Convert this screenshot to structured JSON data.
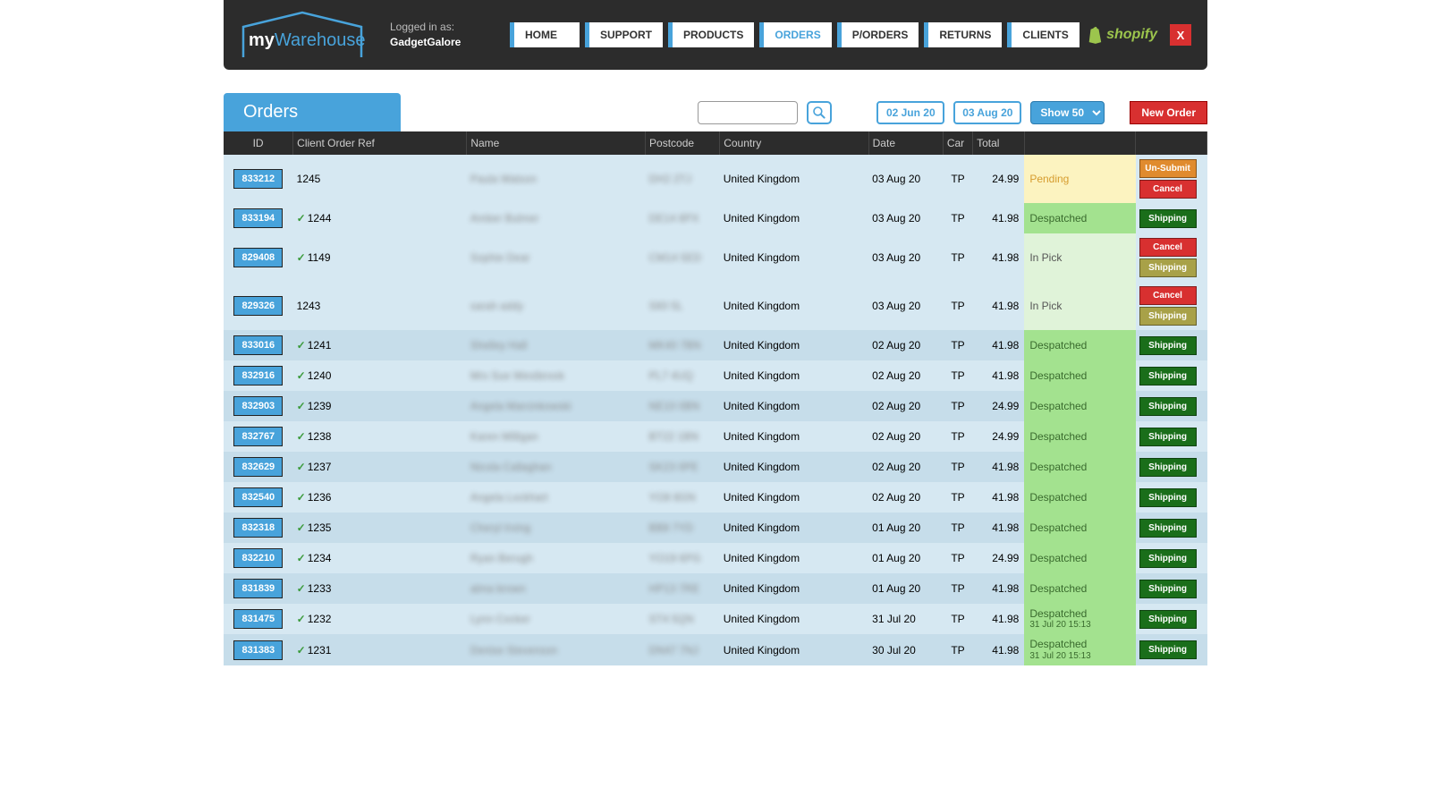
{
  "header": {
    "logo_prefix": "my",
    "logo_suffix": "Warehouse",
    "logged_in_label": "Logged in as:",
    "client_name": "GadgetGalore",
    "shopify_label": "shopify",
    "close_label": "X"
  },
  "nav": [
    {
      "label": "HOME"
    },
    {
      "label": "SUPPORT"
    },
    {
      "label": "PRODUCTS"
    },
    {
      "label": "ORDERS",
      "active": true
    },
    {
      "label": "P/ORDERS"
    },
    {
      "label": "RETURNS"
    },
    {
      "label": "CLIENTS"
    }
  ],
  "toolbar": {
    "title": "Orders",
    "date_from": "02 Jun 20",
    "date_to": "03 Aug 20",
    "show_label": "Show 50",
    "new_order_label": "New Order"
  },
  "columns": {
    "id": "ID",
    "ref": "Client Order Ref",
    "name": "Name",
    "postcode": "Postcode",
    "country": "Country",
    "date": "Date",
    "car": "Car",
    "total": "Total"
  },
  "statuses": {
    "pending": "Pending",
    "despatched": "Despatched",
    "inpick": "In Pick"
  },
  "actions": {
    "unsubmit": "Un-Submit",
    "cancel": "Cancel",
    "shipping": "Shipping"
  },
  "rows": [
    {
      "id": "833212",
      "chk": false,
      "ref": "1245",
      "name": "Paula Watson",
      "post": "DH2 2TJ",
      "country": "United Kingdom",
      "date": "03 Aug 20",
      "car": "TP",
      "total": "24.99",
      "status": "pending",
      "actions": [
        "unsubmit",
        "cancel"
      ]
    },
    {
      "id": "833194",
      "chk": true,
      "ref": "1244",
      "name": "Amber Bulmer",
      "post": "DE14 8PX",
      "country": "United Kingdom",
      "date": "03 Aug 20",
      "car": "TP",
      "total": "41.98",
      "status": "despatched",
      "actions": [
        "shipping-green"
      ]
    },
    {
      "id": "829408",
      "chk": true,
      "ref": "1149",
      "name": "Sophie Dear",
      "post": "CM14 5ED",
      "country": "United Kingdom",
      "date": "03 Aug 20",
      "car": "TP",
      "total": "41.98",
      "status": "inpick",
      "actions": [
        "cancel",
        "shipping-olive"
      ]
    },
    {
      "id": "829326",
      "chk": false,
      "ref": "1243",
      "name": "sarah addy",
      "post": "S60 5L",
      "country": "United Kingdom",
      "date": "03 Aug 20",
      "car": "TP",
      "total": "41.98",
      "status": "inpick",
      "actions": [
        "cancel",
        "shipping-olive"
      ]
    },
    {
      "id": "833016",
      "chk": true,
      "ref": "1241",
      "name": "Shelley Hall",
      "post": "MK40 7BN",
      "country": "United Kingdom",
      "date": "02 Aug 20",
      "car": "TP",
      "total": "41.98",
      "status": "despatched",
      "actions": [
        "shipping-green"
      ]
    },
    {
      "id": "832916",
      "chk": true,
      "ref": "1240",
      "name": "Mrs Sue Westbrook",
      "post": "PL7 4UQ",
      "country": "United Kingdom",
      "date": "02 Aug 20",
      "car": "TP",
      "total": "41.98",
      "status": "despatched",
      "actions": [
        "shipping-green"
      ]
    },
    {
      "id": "832903",
      "chk": true,
      "ref": "1239",
      "name": "Angela Marcinkowski",
      "post": "NE10 0BN",
      "country": "United Kingdom",
      "date": "02 Aug 20",
      "car": "TP",
      "total": "24.99",
      "status": "despatched",
      "actions": [
        "shipping-green"
      ]
    },
    {
      "id": "832767",
      "chk": true,
      "ref": "1238",
      "name": "Karen Milligan",
      "post": "BT22 1BN",
      "country": "United Kingdom",
      "date": "02 Aug 20",
      "car": "TP",
      "total": "24.99",
      "status": "despatched",
      "actions": [
        "shipping-green"
      ]
    },
    {
      "id": "832629",
      "chk": true,
      "ref": "1237",
      "name": "Nicola Callaghan",
      "post": "SK23 0PE",
      "country": "United Kingdom",
      "date": "02 Aug 20",
      "car": "TP",
      "total": "41.98",
      "status": "despatched",
      "actions": [
        "shipping-green"
      ]
    },
    {
      "id": "832540",
      "chk": true,
      "ref": "1236",
      "name": "Angela Lockhart",
      "post": "YO8 8GN",
      "country": "United Kingdom",
      "date": "02 Aug 20",
      "car": "TP",
      "total": "41.98",
      "status": "despatched",
      "actions": [
        "shipping-green"
      ]
    },
    {
      "id": "832318",
      "chk": true,
      "ref": "1235",
      "name": "Cheryl Irving",
      "post": "BB8 7YD",
      "country": "United Kingdom",
      "date": "01 Aug 20",
      "car": "TP",
      "total": "41.98",
      "status": "despatched",
      "actions": [
        "shipping-green"
      ]
    },
    {
      "id": "832210",
      "chk": true,
      "ref": "1234",
      "name": "Ryan Berugh",
      "post": "YO19 6PG",
      "country": "United Kingdom",
      "date": "01 Aug 20",
      "car": "TP",
      "total": "24.99",
      "status": "despatched",
      "actions": [
        "shipping-green"
      ]
    },
    {
      "id": "831839",
      "chk": true,
      "ref": "1233",
      "name": "alma brown",
      "post": "HP13 7RE",
      "country": "United Kingdom",
      "date": "01 Aug 20",
      "car": "TP",
      "total": "41.98",
      "status": "despatched",
      "actions": [
        "shipping-green"
      ]
    },
    {
      "id": "831475",
      "chk": true,
      "ref": "1232",
      "name": "Lynn Cocker",
      "post": "ST4 5QN",
      "country": "United Kingdom",
      "date": "31 Jul 20",
      "car": "TP",
      "total": "41.98",
      "status": "despatched",
      "sub": "31 Jul 20 15:13",
      "actions": [
        "shipping-green"
      ]
    },
    {
      "id": "831383",
      "chk": true,
      "ref": "1231",
      "name": "Denise Stevenson",
      "post": "DN47 7NJ",
      "country": "United Kingdom",
      "date": "30 Jul 20",
      "car": "TP",
      "total": "41.98",
      "status": "despatched",
      "sub": "31 Jul 20 15:13",
      "actions": [
        "shipping-green"
      ]
    }
  ]
}
